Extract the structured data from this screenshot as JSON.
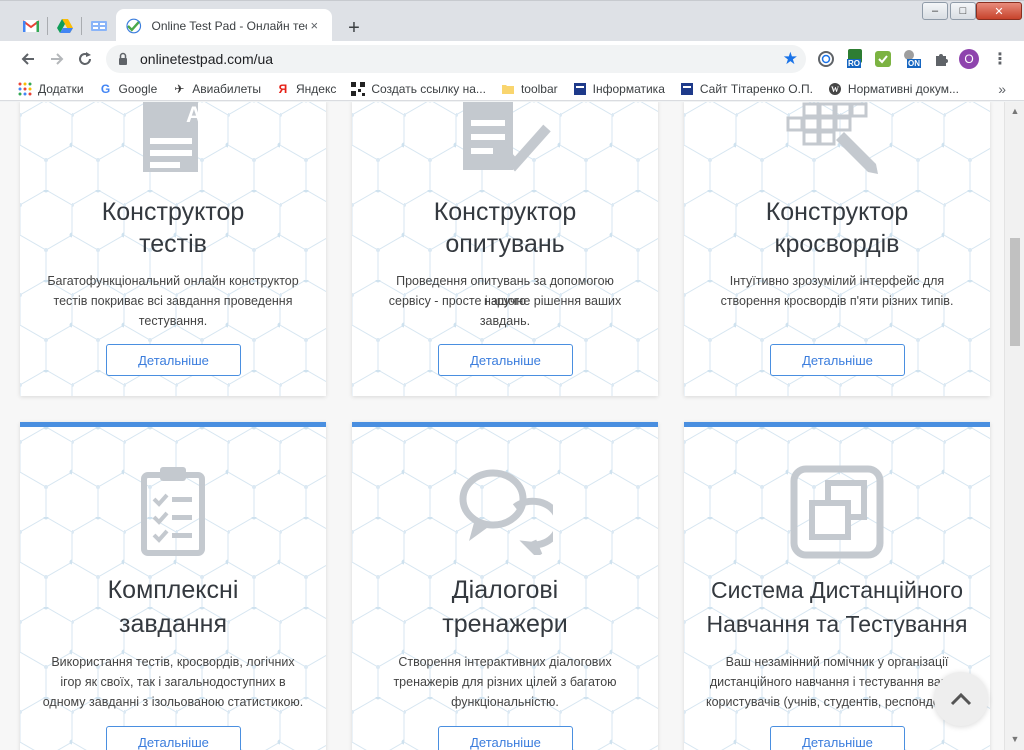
{
  "browser": {
    "active_tab_title": "Online Test Pad - Онлайн тести,",
    "tab_close": "×",
    "new_tab": "+",
    "url": "onlinetestpad.com/ua",
    "profile_initial": "O",
    "ext_badges": [
      "RO",
      "ON"
    ],
    "window_controls": [
      "–",
      "□",
      "✕"
    ]
  },
  "bookmarks": [
    {
      "label": "Додатки",
      "icon": "apps-grid-icon"
    },
    {
      "label": "Google",
      "icon": "google-icon"
    },
    {
      "label": "Авиабилеты",
      "icon": "plane-icon"
    },
    {
      "label": "Яндекс",
      "icon": "yandex-icon"
    },
    {
      "label": "Создать ссылку на...",
      "icon": "qr-icon"
    },
    {
      "label": "toolbar",
      "icon": "folder-icon"
    },
    {
      "label": "Інформатика",
      "icon": "site-icon"
    },
    {
      "label": "Сайт Тітаренко О.П.",
      "icon": "site-icon"
    },
    {
      "label": "Нормативні докум...",
      "icon": "wordpress-icon"
    }
  ],
  "bookmarks_more": "»",
  "cards": [
    {
      "title_line1": "Конструктор",
      "title_line2": "тестів",
      "desc_line1": "Багатофункціональний онлайн конструктор",
      "desc_line2": "тестів покриває всі завдання проведення",
      "desc_line3": "тестування.",
      "button": "Детальніше",
      "icon": "test-document-icon"
    },
    {
      "title_line1": "Конструктор",
      "title_line2": "опитувань",
      "desc_line1": "Проведення опитувань за допомогою нашого",
      "desc_line2": "сервісу - просте і зручне рішення ваших",
      "desc_line3": "завдань.",
      "button": "Детальніше",
      "icon": "survey-check-icon"
    },
    {
      "title_line1": "Конструктор",
      "title_line2": "кросвордів",
      "desc_line1": "Інтуїтивно зрозумілий інтерфейс для",
      "desc_line2": "створення кросвордів п'яти різних типів.",
      "desc_line3": "",
      "button": "Детальніше",
      "icon": "crossword-pencil-icon"
    },
    {
      "title_line1": "Комплексні",
      "title_line2": "завдання",
      "desc_line1": "Використання тестів, кросвордів, логічних",
      "desc_line2": "ігор як своїх, так і загальнодоступних в",
      "desc_line3": "одному завданні з ізольованою статистикою.",
      "button": "Детальніше",
      "icon": "clipboard-checklist-icon"
    },
    {
      "title_line1": "Діалогові",
      "title_line2": "тренажери",
      "desc_line1": "Створення інтерактивних діалогових",
      "desc_line2": "тренажерів для різних цілей з багатою",
      "desc_line3": "функціональністю.",
      "button": "Детальніше",
      "icon": "dialog-bubbles-icon"
    },
    {
      "title_line1": "Система Дистанційного",
      "title_line2": "Навчання та Тестування",
      "desc_line1": "Ваш незамінний помічник у організації",
      "desc_line2": "дистанційного навчання і тестування ваших",
      "desc_line3": "користувачів (учнів, студентів, респондентів).",
      "button": "Детальніше",
      "icon": "windows-stack-icon"
    }
  ],
  "colors": {
    "accent": "#4a8fe0",
    "icon_gray": "#c4c9cf",
    "title": "#34393f"
  }
}
